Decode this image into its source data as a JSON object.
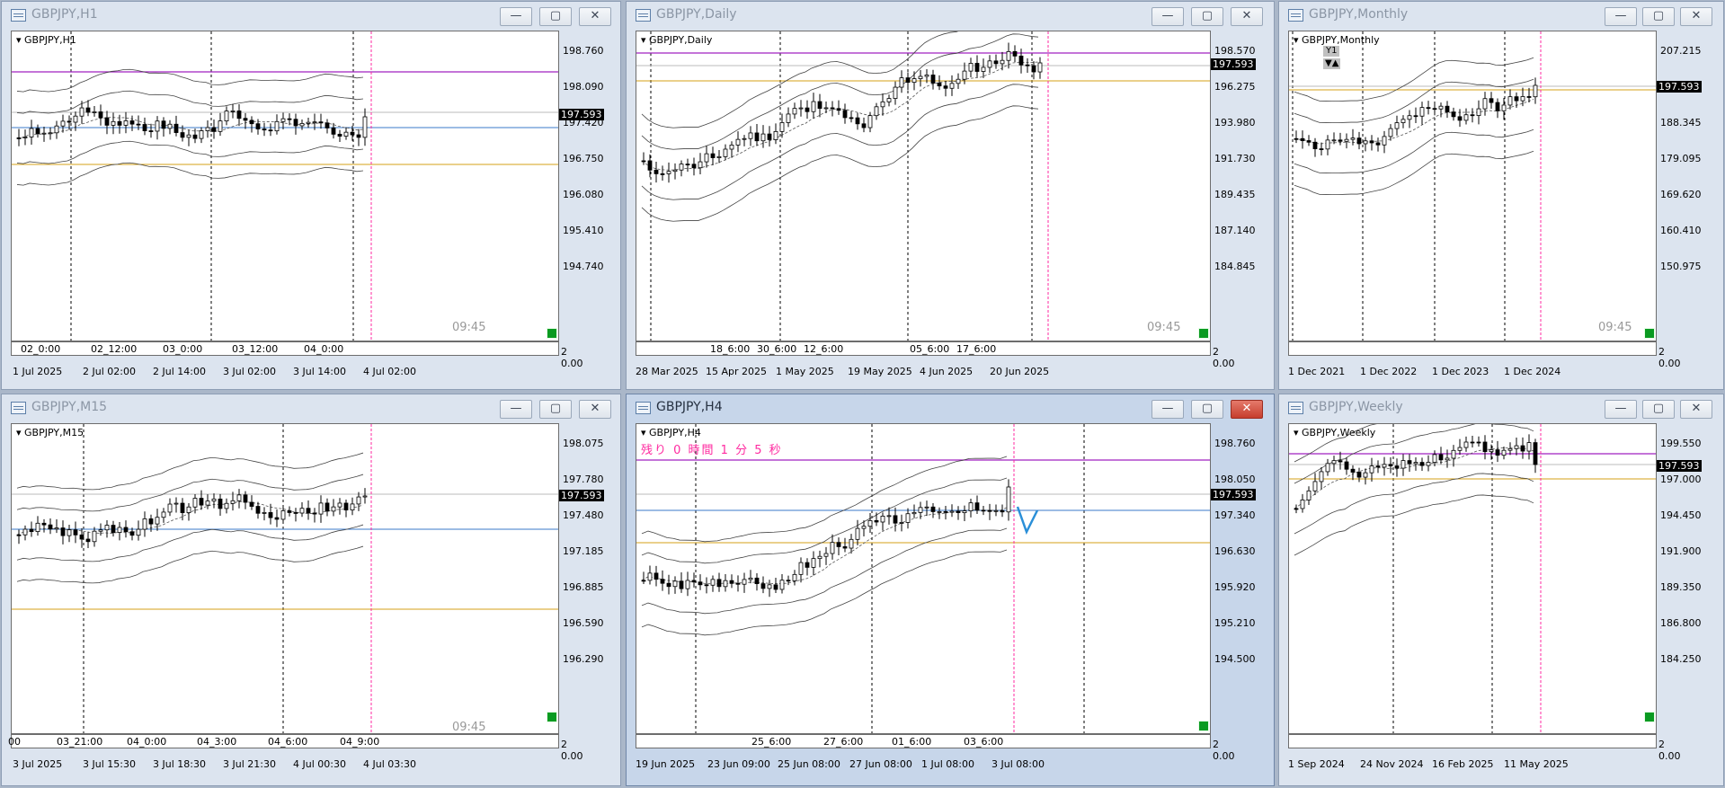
{
  "current_price": "197.593",
  "windows": [
    {
      "id": "h1",
      "title": "GBPJPY,H1",
      "chart_label": "GBPJPY,H1",
      "active": false,
      "prices": [
        "198.760",
        "198.090",
        "197.420",
        "196.750",
        "196.080",
        "195.410",
        "194.740"
      ],
      "inner_times": [
        "02_0:00",
        "02_12:00",
        "03_0:00",
        "03_12:00",
        "04_0:00"
      ],
      "bottom_times": [
        "1 Jul 2025",
        "2 Jul 02:00",
        "2 Jul 14:00",
        "3 Jul 02:00",
        "3 Jul 14:00",
        "4 Jul 02:00"
      ],
      "clock": "09:45",
      "axis_small": "2",
      "axis_small2": "0.00"
    },
    {
      "id": "daily",
      "title": "GBPJPY,Daily",
      "chart_label": "GBPJPY,Daily",
      "active": false,
      "prices": [
        "198.570",
        "196.275",
        "193.980",
        "191.730",
        "189.435",
        "187.140",
        "184.845"
      ],
      "inner_times": [
        "18_6:00",
        "30_6:00",
        "12_6:00",
        "05_6:00",
        "17_6:00"
      ],
      "bottom_times": [
        "28 Mar 2025",
        "15 Apr 2025",
        "1 May 2025",
        "19 May 2025",
        "4 Jun 2025",
        "20 Jun 2025"
      ],
      "clock": "09:45",
      "axis_small": "2",
      "axis_small2": "0.00"
    },
    {
      "id": "monthly",
      "title": "GBPJPY,Monthly",
      "chart_label": "GBPJPY,Monthly",
      "active": false,
      "badge": "Y1",
      "prices": [
        "207.215",
        "197.593",
        "188.345",
        "179.095",
        "169.620",
        "160.410",
        "150.975"
      ],
      "bottom_times": [
        "1 Dec 2021",
        "1 Dec 2022",
        "1 Dec 2023",
        "1 Dec 2024"
      ],
      "clock": "09:45",
      "axis_small": "2",
      "axis_small2": "0.00"
    },
    {
      "id": "m15",
      "title": "GBPJPY,M15",
      "chart_label": "GBPJPY,M15",
      "active": false,
      "prices": [
        "198.075",
        "197.780",
        "197.480",
        "197.185",
        "196.885",
        "196.590",
        "196.290"
      ],
      "inner_times": [
        "00",
        "03_21:00",
        "04_0:00",
        "04_3:00",
        "04_6:00",
        "04_9:00"
      ],
      "bottom_times": [
        "3 Jul 2025",
        "3 Jul 15:30",
        "3 Jul 18:30",
        "3 Jul 21:30",
        "4 Jul 00:30",
        "4 Jul 03:30"
      ],
      "clock": "09:45",
      "axis_small": "2",
      "axis_small2": "0.00"
    },
    {
      "id": "h4",
      "title": "GBPJPY,H4",
      "chart_label": "GBPJPY,H4",
      "active": true,
      "timer": "残り 0 時間 1 分 5 秒",
      "prices": [
        "198.760",
        "198.050",
        "197.340",
        "196.630",
        "195.920",
        "195.210",
        "194.500"
      ],
      "inner_times": [
        "25_6:00",
        "27_6:00",
        "01_6:00",
        "03_6:00"
      ],
      "bottom_times": [
        "19 Jun 2025",
        "23 Jun 09:00",
        "25 Jun 08:00",
        "27 Jun 08:00",
        "1 Jul 08:00",
        "3 Jul 08:00"
      ],
      "axis_small": "2",
      "axis_small2": "0.00"
    },
    {
      "id": "weekly",
      "title": "GBPJPY,Weekly",
      "chart_label": "GBPJPY,Weekly",
      "active": false,
      "prices": [
        "199.550",
        "197.000",
        "194.450",
        "191.900",
        "189.350",
        "186.800",
        "184.250"
      ],
      "bottom_times": [
        "1 Sep 2024",
        "24 Nov 2024",
        "16 Feb 2025",
        "11 May 2025"
      ],
      "axis_small": "2",
      "axis_small2": "0.00"
    }
  ],
  "buttons": {
    "minimize": "—",
    "maximize": "▢",
    "close": "✕"
  },
  "colors": {
    "magenta_line": "#a020c0",
    "orange_line": "#d4a017",
    "blue_line": "#3a78c8",
    "pink_vline": "#ff2aa0",
    "green": "#0a9a21"
  }
}
